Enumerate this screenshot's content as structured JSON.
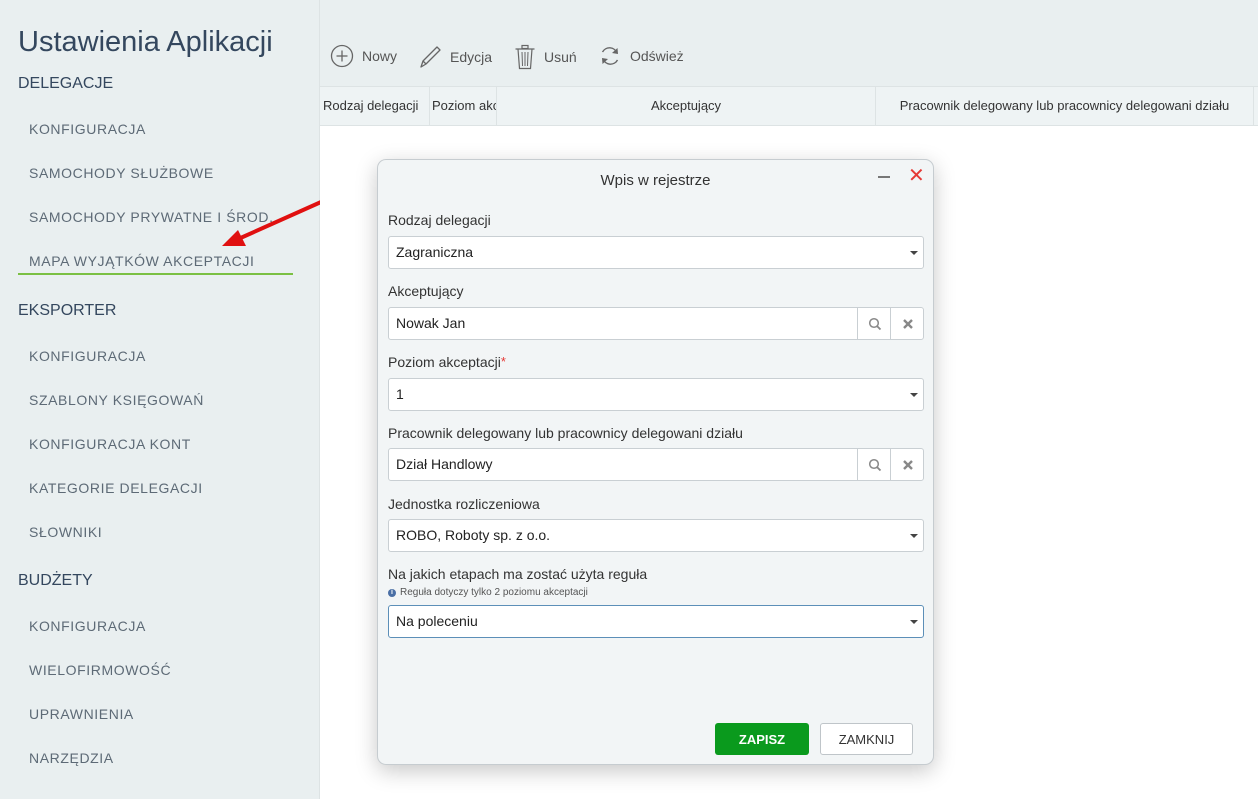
{
  "app": {
    "title": "Ustawienia Aplikacji"
  },
  "sidebar": {
    "sections": [
      {
        "title": "DELEGACJE",
        "items": [
          "KONFIGURACJA",
          "SAMOCHODY SŁUŻBOWE",
          "SAMOCHODY PRYWATNE I ŚROD...",
          "MAPA WYJĄTKÓW AKCEPTACJI"
        ]
      },
      {
        "title": "EKSPORTER",
        "items": [
          "KONFIGURACJA",
          "SZABLONY KSIĘGOWAŃ",
          "KONFIGURACJA KONT",
          "KATEGORIE DELEGACJI",
          "SŁOWNIKI"
        ]
      },
      {
        "title": "BUDŻETY",
        "items": [
          "KONFIGURACJA",
          "WIELOFIRMOWOŚĆ",
          "UPRAWNIENIA",
          "NARZĘDZIA"
        ]
      }
    ],
    "active_item": "MAPA WYJĄTKÓW AKCEPTACJI"
  },
  "toolbar": {
    "new": "Nowy",
    "edit": "Edycja",
    "delete": "Usuń",
    "refresh": "Odśwież"
  },
  "grid": {
    "columns": [
      "Rodzaj delegacji",
      "Poziom akceptacji",
      "Akceptujący",
      "Pracownik delegowany lub pracownicy delegowani działu"
    ]
  },
  "dialog": {
    "title": "Wpis w rejestrze",
    "fields": {
      "rodzaj": {
        "label": "Rodzaj delegacji",
        "value": "Zagraniczna"
      },
      "akceptujacy": {
        "label": "Akceptujący",
        "value": "Nowak Jan"
      },
      "poziom": {
        "label": "Poziom akceptacji",
        "required_mark": "*",
        "value": "1"
      },
      "pracownik": {
        "label": "Pracownik delegowany lub pracownicy delegowani działu",
        "value": "Dział Handlowy"
      },
      "jednostka": {
        "label": "Jednostka rozliczeniowa",
        "value": "ROBO, Roboty sp. z o.o."
      },
      "etapy": {
        "label": "Na jakich etapach ma zostać użyta reguła",
        "hint": "Reguła dotyczy tylko 2 poziomu akceptacji",
        "value": "Na poleceniu"
      }
    },
    "buttons": {
      "save": "ZAPISZ",
      "close": "ZAMKNIJ"
    }
  },
  "colors": {
    "accent_green": "#0a9a1d",
    "active_underline": "#7bc043",
    "close_red": "#e53935",
    "arrow_red": "#e01010"
  }
}
